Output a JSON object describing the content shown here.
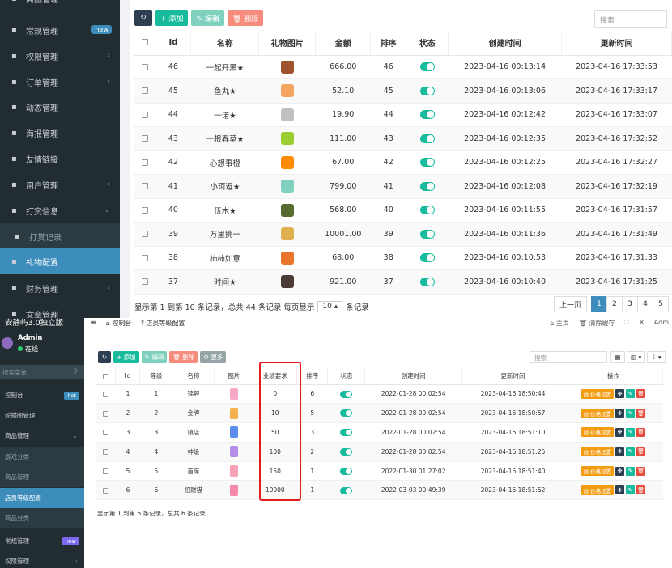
{
  "top": {
    "sidebar": [
      {
        "icon": "tags-icon",
        "label": "商品管理",
        "caret": "‹"
      },
      {
        "icon": "cogs-icon",
        "label": "常规管理",
        "badge": "new"
      },
      {
        "icon": "group-icon",
        "label": "权限管理",
        "caret": "‹"
      },
      {
        "icon": "list-icon",
        "label": "订单管理",
        "caret": "‹"
      },
      {
        "icon": "eye-icon",
        "label": "动态管理"
      },
      {
        "icon": "image-icon",
        "label": "海报管理"
      },
      {
        "icon": "link-icon",
        "label": "友情链接"
      },
      {
        "icon": "user-icon",
        "label": "用户管理",
        "caret": "‹"
      },
      {
        "icon": "gift-icon",
        "label": "打赏信息",
        "caret": "⌄"
      },
      {
        "icon": "list-icon",
        "label": "打赏记录"
      },
      {
        "icon": "cube-icon",
        "label": "礼物配置"
      },
      {
        "icon": "yen-icon",
        "label": "财务管理",
        "caret": "‹"
      },
      {
        "icon": "file-icon",
        "label": "文章管理"
      }
    ],
    "toolbar": {
      "refresh": "↻",
      "add": "+ 添加",
      "edit": "✎ 编辑",
      "delete": "🗑 删除"
    },
    "search_placeholder": "搜索",
    "columns": [
      "",
      "Id",
      "名称",
      "礼物图片",
      "金额",
      "排序",
      "状态",
      "创建时间",
      "更新时间"
    ],
    "rows": [
      {
        "id": "46",
        "name": "一起开黑★",
        "img": "#a0522d",
        "amount": "666.00",
        "sort": "46",
        "created": "2023-04-16 00:13:14",
        "updated": "2023-04-16 17:33:53"
      },
      {
        "id": "45",
        "name": "鱼丸★",
        "img": "#f4a460",
        "amount": "52.10",
        "sort": "45",
        "created": "2023-04-16 00:13:06",
        "updated": "2023-04-16 17:33:17"
      },
      {
        "id": "44",
        "name": "一诺★",
        "img": "#c0c0c0",
        "amount": "19.90",
        "sort": "44",
        "created": "2023-04-16 00:12:42",
        "updated": "2023-04-16 17:33:07"
      },
      {
        "id": "43",
        "name": "一根春草★",
        "img": "#9acd32",
        "amount": "111.00",
        "sort": "43",
        "created": "2023-04-16 00:12:35",
        "updated": "2023-04-16 17:32:52"
      },
      {
        "id": "42",
        "name": "心想事橙",
        "img": "#ff8c00",
        "amount": "67.00",
        "sort": "42",
        "created": "2023-04-16 00:12:25",
        "updated": "2023-04-16 17:32:27"
      },
      {
        "id": "41",
        "name": "小珂逗★",
        "img": "#7fd1be",
        "amount": "799.00",
        "sort": "41",
        "created": "2023-04-16 00:12:08",
        "updated": "2023-04-16 17:32:19"
      },
      {
        "id": "40",
        "name": "伍木★",
        "img": "#556b2f",
        "amount": "568.00",
        "sort": "40",
        "created": "2023-04-16 00:11:55",
        "updated": "2023-04-16 17:31:57"
      },
      {
        "id": "39",
        "name": "万里挑一",
        "img": "#e0b050",
        "amount": "10001.00",
        "sort": "39",
        "created": "2023-04-16 00:11:36",
        "updated": "2023-04-16 17:31:49"
      },
      {
        "id": "38",
        "name": "柿柿如意",
        "img": "#e9742a",
        "amount": "68.00",
        "sort": "38",
        "created": "2023-04-16 00:10:53",
        "updated": "2023-04-16 17:31:33"
      },
      {
        "id": "37",
        "name": "时间★",
        "img": "#4a3a35",
        "amount": "921.00",
        "sort": "37",
        "created": "2023-04-16 00:10:40",
        "updated": "2023-04-16 17:31:25"
      }
    ],
    "footer": {
      "pre": "显示第 1 到第 10 条记录，总共 44 条记录 每页显示",
      "per_page": "10 ▴",
      "post": "条记录"
    },
    "pager": [
      "上一页",
      "1",
      "2",
      "3",
      "4",
      "5"
    ]
  },
  "bottom": {
    "app_title": "安静屿3.0独立版",
    "topnav": [
      "≡",
      "⌂ 控制台",
      "⤒ 店员等级配置"
    ],
    "topright": [
      "⌂ 主页",
      "🗑 清除缓存",
      "⛶",
      "✕",
      "Adm"
    ],
    "user": {
      "name": "Admin",
      "status": "在线"
    },
    "search_placeholder": "搜索菜单",
    "sidebar": [
      {
        "label": "控制台",
        "badge": "hot"
      },
      {
        "label": "轮播图管理"
      },
      {
        "label": "商品管理",
        "caret": "⌄"
      },
      {
        "label": "游戏分类"
      },
      {
        "label": "商品管理"
      },
      {
        "label": "店员等级配置"
      },
      {
        "label": "商品分类"
      },
      {
        "label": "常规管理",
        "badge": "new"
      },
      {
        "label": "权限管理",
        "caret": "‹"
      }
    ],
    "toolbar": {
      "refresh": "↻",
      "add": "+ 添加",
      "edit": "✎ 编辑",
      "delete": "🗑 删除",
      "more": "⚙ 更多"
    },
    "search_placeholder2": "搜索",
    "tools": [
      "▦",
      "▥ ▾",
      "⇩ ▾"
    ],
    "columns": [
      "",
      "Id",
      "等级",
      "名称",
      "图片",
      "业绩要求",
      "排序",
      "状态",
      "创建时间",
      "更新时间",
      "操作"
    ],
    "rows": [
      {
        "id": "1",
        "level": "1",
        "name": "锦鲤",
        "img": "#f7a8c9",
        "req": "0",
        "sort": "6",
        "created": "2022-01-28 00:02:54",
        "updated": "2023-04-16 18:50:44"
      },
      {
        "id": "2",
        "level": "2",
        "name": "金牌",
        "img": "#f5b14e",
        "req": "10",
        "sort": "5",
        "created": "2022-01-28 00:02:54",
        "updated": "2023-04-16 18:50:57"
      },
      {
        "id": "3",
        "level": "3",
        "name": "镇店",
        "img": "#5b8def",
        "req": "50",
        "sort": "3",
        "created": "2022-01-28 00:02:54",
        "updated": "2023-04-16 18:51:10"
      },
      {
        "id": "4",
        "level": "4",
        "name": "神级",
        "img": "#b58ce8",
        "req": "100",
        "sort": "2",
        "created": "2022-01-28 00:02:54",
        "updated": "2023-04-16 18:51:25"
      },
      {
        "id": "5",
        "level": "5",
        "name": "首席",
        "img": "#f7a1b5",
        "req": "150",
        "sort": "1",
        "created": "2022-01-30 01:27:02",
        "updated": "2023-04-16 18:51:40"
      },
      {
        "id": "6",
        "level": "6",
        "name": "招财猫",
        "img": "#f48aa8",
        "req": "10000",
        "sort": "1",
        "created": "2022-03-03 00:49:39",
        "updated": "2023-04-16 18:51:52"
      }
    ],
    "op_label": "▤ 价格设置",
    "footer": "显示第 1 到第 6 条记录，总共 6 条记录"
  },
  "colors": {
    "accent": "#3c8dbc",
    "success": "#18bc9c",
    "warning": "#f39c12",
    "danger": "#e74c3c",
    "sidebar": "#222d32",
    "highlight_box": "#e31b1b"
  }
}
